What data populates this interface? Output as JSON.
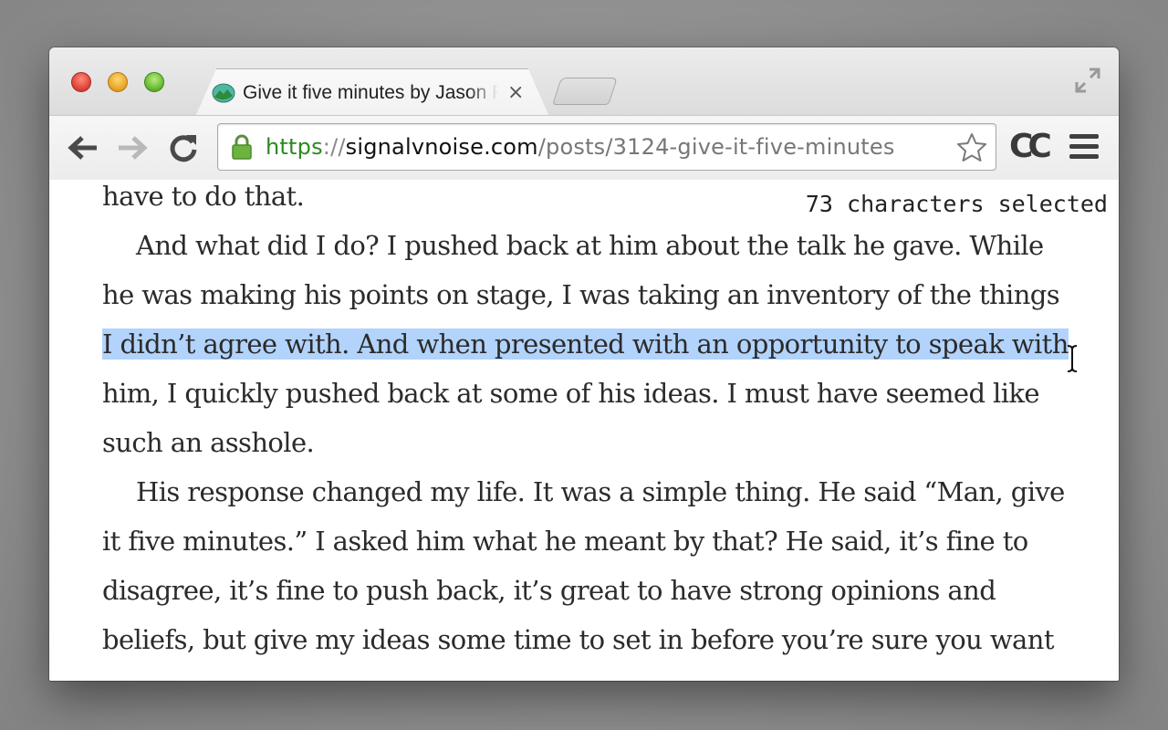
{
  "browser": {
    "tab": {
      "title": "Give it five minutes by Jason Fried",
      "close": "×"
    },
    "omnibox": {
      "scheme": "https",
      "separator": "://",
      "host": "signalvnoise.com",
      "path": "/posts/3124-give-it-five-minutes"
    },
    "extension_label": "CC"
  },
  "page": {
    "lines": [
      {
        "text": "have to do that.",
        "indent": false
      },
      {
        "text": "And what did I do? I pushed back at him about the talk he gave. While",
        "indent": true
      },
      {
        "text": "he was making his points on stage, I was taking an inventory of the things",
        "indent": false
      },
      {
        "text": "I didn’t agree with. And when presented with an opportunity to speak with",
        "indent": false,
        "selected": true
      },
      {
        "text": "him, I quickly pushed back at some of his ideas. I must have seemed like",
        "indent": false
      },
      {
        "text": "such an asshole.",
        "indent": false
      },
      {
        "text": "His response changed my life. It was a simple thing. He said “Man, give",
        "indent": true
      },
      {
        "text": "it five minutes.” I asked him what he meant by that? He said, it’s fine to",
        "indent": false
      },
      {
        "text": "disagree, it’s fine to push back, it’s great to have strong opinions and",
        "indent": false
      },
      {
        "text": "beliefs, but give my ideas some time to set in before you’re sure you want",
        "indent": false
      }
    ],
    "selection_status": "73 characters selected",
    "selection_color": "#b2d3fb"
  }
}
